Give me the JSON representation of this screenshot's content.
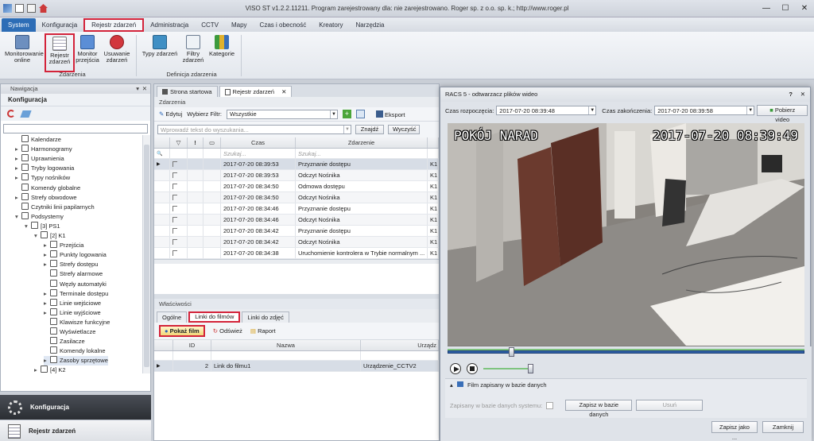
{
  "window": {
    "title": "VISO ST v1.2.2.11211. Program zarejestrowany dla: nie zarejestrowano. Roger sp. z o.o. sp. k.; http://www.roger.pl"
  },
  "menu": {
    "items": [
      "System",
      "Konfiguracja",
      "Rejestr zdarzeń",
      "Administracja",
      "CCTV",
      "Mapy",
      "Czas i obecność",
      "Kreatory",
      "Narzędzia"
    ]
  },
  "ribbon": {
    "group1": {
      "label": "Zdarzenia",
      "buttons": [
        "Monitorowanie online",
        "Rejestr zdarzeń",
        "Monitor przejścia",
        "Usuwanie zdarzeń"
      ]
    },
    "group2": {
      "label": "Definicja zdarzenia",
      "buttons": [
        "Typy zdarzeń",
        "Filtry zdarzeń",
        "Kategorie"
      ]
    }
  },
  "nav": {
    "header": "Nawigacja",
    "title": "Konfiguracja",
    "tree": [
      "Kalendarze",
      "Harmonogramy",
      "Uprawnienia",
      "Tryby logowania",
      "Typy nośników",
      "Komendy globalne",
      "Strefy obwodowe",
      "Czytniki linii papilarnych",
      "Podsystemy",
      "[3] PS1",
      "[2] K1",
      "Przejścia",
      "Punkty logowania",
      "Strefy dostępu",
      "Strefy alarmowe",
      "Węzły automatyki",
      "Terminale dostępu",
      "Linie wejściowe",
      "Linie wyjściowe",
      "Klawisze funkcyjne",
      "Wyświetlacze",
      "Zasilacze",
      "Komendy lokalne",
      "Zasoby sprzętowe",
      "[4] K2"
    ],
    "bottom": {
      "active": "Konfiguracja",
      "other": "Rejestr zdarzeń"
    }
  },
  "doc": {
    "tabs": [
      "Strona startowa",
      "Rejestr zdarzeń"
    ],
    "section": "Zdarzenia",
    "toolbar": {
      "edit": "Edytuj",
      "filter_label": "Wybierz Filtr:",
      "filter_value": "Wszystkie",
      "export": "Eksport"
    },
    "search": {
      "placeholder": "Wprowadź tekst do wyszukania...",
      "find": "Znajdź",
      "clear": "Wyczyść"
    },
    "grid": {
      "headers": [
        "Czas",
        "Zdarzenie"
      ],
      "filter_placeholder": "Szukaj...",
      "rows": [
        [
          "2017-07-20 08:39:53",
          "Przyznanie dostępu",
          "K1"
        ],
        [
          "2017-07-20 08:39:53",
          "Odczyt Nośnika",
          "K1"
        ],
        [
          "2017-07-20 08:34:50",
          "Odmowa dostępu",
          "K1"
        ],
        [
          "2017-07-20 08:34:50",
          "Odczyt Nośnika",
          "K1"
        ],
        [
          "2017-07-20 08:34:46",
          "Przyznanie dostępu",
          "K1"
        ],
        [
          "2017-07-20 08:34:46",
          "Odczyt Nośnika",
          "K1"
        ],
        [
          "2017-07-20 08:34:42",
          "Przyznanie dostępu",
          "K1"
        ],
        [
          "2017-07-20 08:34:42",
          "Odczyt Nośnika",
          "K1"
        ],
        [
          "2017-07-20 08:34:38",
          "Uruchomienie kontrolera w Trybie normalnym ...",
          "K1"
        ]
      ]
    },
    "props": {
      "title": "Właściwości",
      "tabs": [
        "Ogólne",
        "Linki do filmów",
        "Linki do zdjęć"
      ],
      "toolbar": {
        "show": "Pokaż film",
        "refresh": "Odśwież",
        "report": "Raport"
      },
      "headers": [
        "ID",
        "Nazwa",
        "Urządz"
      ],
      "row": {
        "id": "2",
        "name": "Link do filmu1",
        "device": "Urządzenie_CCTV2"
      }
    }
  },
  "player": {
    "title": "RACS 5 - odtwarzacz plików wideo",
    "start_label": "Czas rozpoczęcia:",
    "start_value": "2017-07-20 08:39:48",
    "end_label": "Czas zakończenia:",
    "end_value": "2017-07-20 08:39:58",
    "fetch": "Pobierz video",
    "osd_room": "POKÓJ NARAD",
    "osd_time": "2017-07-20 08:39:49",
    "saved_title": "Film zapisany w bazie danych",
    "saved_check": "Zapisany w bazie danych systemu:",
    "save_db": "Zapisz w bazie danych",
    "remove": "Usuń",
    "save_as": "Zapisz jako ...",
    "close": "Zamknij",
    "playback_fraction": 0.17
  }
}
